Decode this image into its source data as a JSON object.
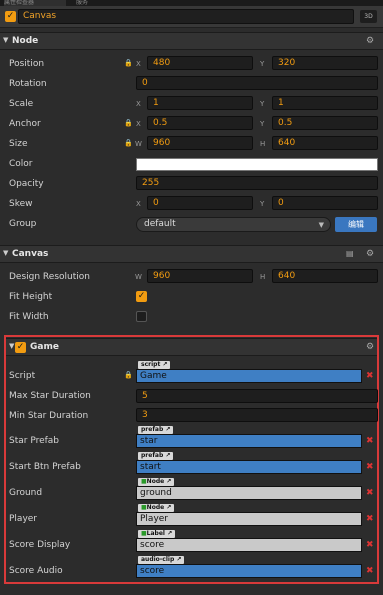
{
  "tabs": [
    "属性检查器",
    "服务"
  ],
  "node": {
    "name": "Canvas",
    "badge": "3D"
  },
  "sections": {
    "node": "Node",
    "canvas": "Canvas",
    "game": "Game"
  },
  "node_props": {
    "position": {
      "label": "Position",
      "x": "480",
      "y": "320"
    },
    "rotation": {
      "label": "Rotation",
      "value": "0"
    },
    "scale": {
      "label": "Scale",
      "x": "1",
      "y": "1"
    },
    "anchor": {
      "label": "Anchor",
      "x": "0.5",
      "y": "0.5"
    },
    "size": {
      "label": "Size",
      "w": "960",
      "h": "640"
    },
    "color": {
      "label": "Color",
      "value": "#ffffff"
    },
    "opacity": {
      "label": "Opacity",
      "value": "255"
    },
    "skew": {
      "label": "Skew",
      "x": "0",
      "y": "0"
    },
    "group": {
      "label": "Group",
      "value": "default",
      "edit": "编辑"
    }
  },
  "axes": {
    "x": "X",
    "y": "Y",
    "w": "W",
    "h": "H"
  },
  "canvas_props": {
    "design_resolution": {
      "label": "Design Resolution",
      "w": "960",
      "h": "640"
    },
    "fit_height": {
      "label": "Fit Height",
      "checked": true
    },
    "fit_width": {
      "label": "Fit Width",
      "checked": false
    }
  },
  "game_props": {
    "script": {
      "label": "Script",
      "tag": "script",
      "value": "Game"
    },
    "max_star_duration": {
      "label": "Max Star Duration",
      "value": "5"
    },
    "min_star_duration": {
      "label": "Min Star Duration",
      "value": "3"
    },
    "star_prefab": {
      "label": "Star Prefab",
      "tag": "prefab",
      "value": "star"
    },
    "start_btn_prefab": {
      "label": "Start Btn Prefab",
      "tag": "prefab",
      "value": "start"
    },
    "ground": {
      "label": "Ground",
      "tag": "Node",
      "value": "ground"
    },
    "player": {
      "label": "Player",
      "tag": "Node",
      "value": "Player"
    },
    "score_display": {
      "label": "Score Display",
      "tag": "Label",
      "value": "score"
    },
    "score_audio": {
      "label": "Score Audio",
      "tag": "audio-clip",
      "value": "score"
    }
  },
  "icons": {
    "check": "checkmark-icon",
    "lock": "lock-icon",
    "gear": "gear-icon",
    "book": "book-icon",
    "arrow": "triangle-down-icon",
    "remove": "close-icon",
    "link": "external-link-icon",
    "dropdown": "dropdown-arrow-icon"
  },
  "colors": {
    "accent": "#f29c11",
    "blue_ref": "#3f7fc4",
    "highlight": "#d93a3a",
    "edit_button": "#3a77c0"
  }
}
